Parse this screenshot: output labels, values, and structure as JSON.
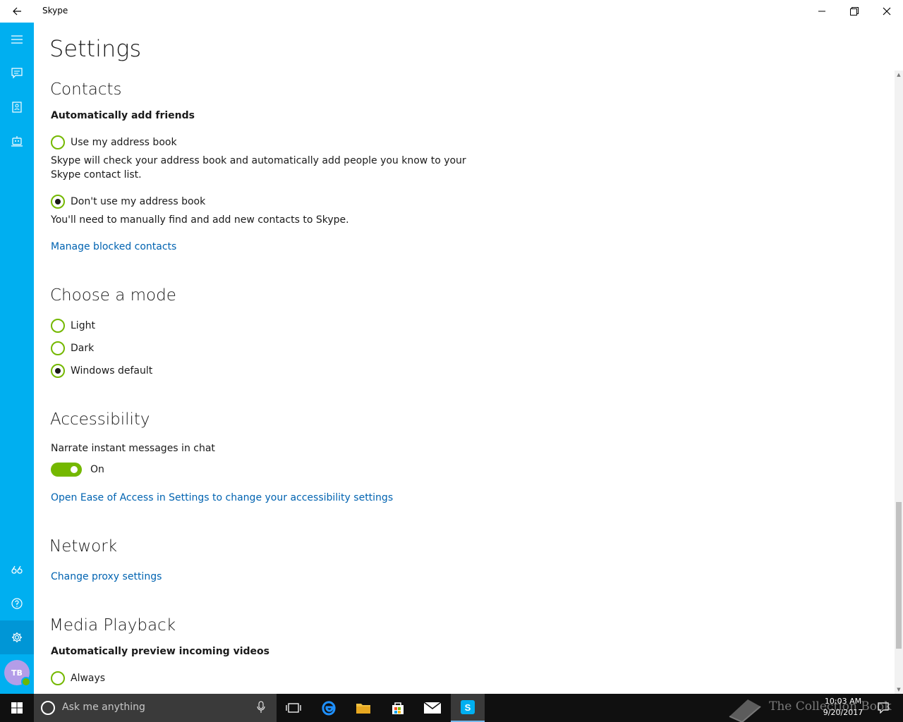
{
  "app": {
    "title": "Skype"
  },
  "colors": {
    "sidebar": "#00aff0",
    "accent_green": "#74b800",
    "link": "#0063b1",
    "taskbar": "#101010"
  },
  "sidebar": {
    "top_icons": [
      "menu-icon",
      "chat-icon",
      "contacts-icon",
      "bot-icon"
    ],
    "bottom_icons": [
      "feedback-icon",
      "help-icon",
      "gear-icon"
    ],
    "avatar_initials": "TB"
  },
  "settings": {
    "title": "Settings",
    "contacts": {
      "heading": "Contacts",
      "auto_add_label": "Automatically add friends",
      "use_address_book": "Use my address book",
      "use_address_book_desc_1": "Skype will check your address book and automatically add people you know to your",
      "use_address_book_desc_2": "Skype contact list.",
      "dont_use_address_book": "Don't use my address book",
      "dont_use_desc": "You'll need to manually find and add new contacts to Skype.",
      "selected": "Don't use my address book",
      "manage_blocked": "Manage blocked contacts"
    },
    "mode": {
      "heading": "Choose a mode",
      "options": [
        "Light",
        "Dark",
        "Windows default"
      ],
      "selected": "Windows default"
    },
    "accessibility": {
      "heading": "Accessibility",
      "narrate_label": "Narrate instant messages in chat",
      "toggle_state": "On",
      "ease_link": "Open Ease of Access in Settings to change your accessibility settings"
    },
    "network": {
      "heading": "Network",
      "proxy_link": "Change proxy settings"
    },
    "media": {
      "heading": "Media Playback",
      "preview_label": "Automatically preview incoming videos",
      "first_option": "Always"
    }
  },
  "taskbar": {
    "search_placeholder": "Ask me anything",
    "time": "10:03 AM",
    "date": "9/20/2017",
    "watermark": "The Collection Book"
  }
}
